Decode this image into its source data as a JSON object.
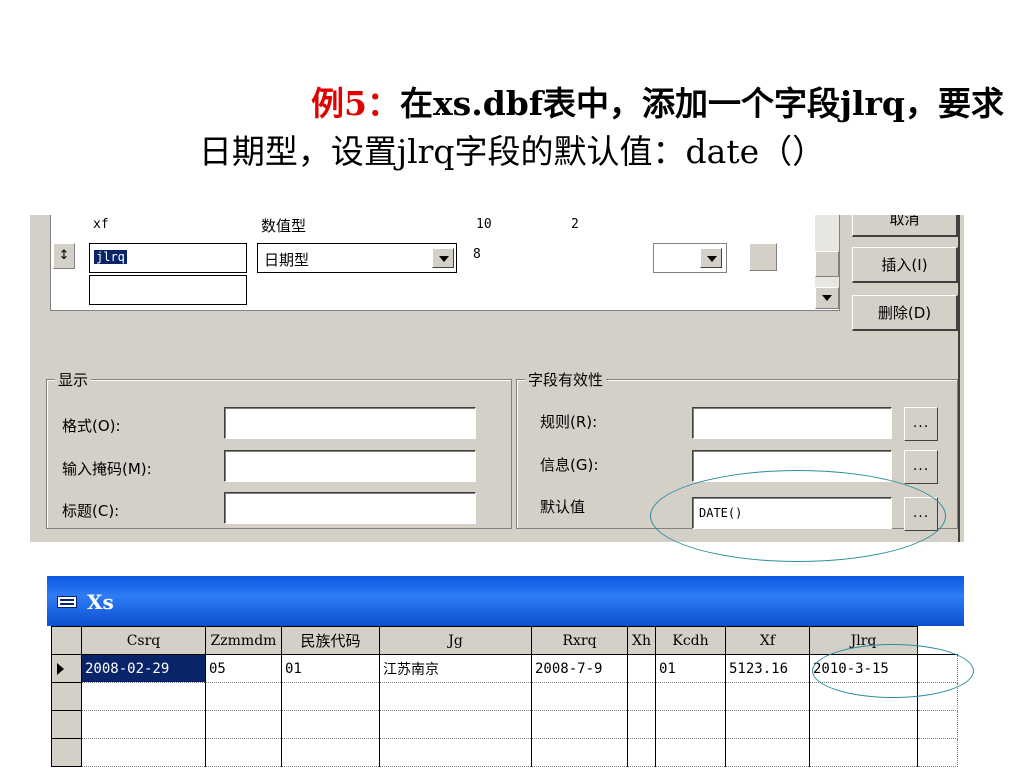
{
  "title": {
    "example_label": "例5：",
    "line1_text": "在xs.dbf表中，添加一个字段jlrq，要求",
    "line2_text": "日期型，设置jlrq字段的默认值：date（）"
  },
  "field_grid": {
    "row_prev": {
      "name": "xf",
      "type": "数值型",
      "width": "10",
      "decimal": "2"
    },
    "row_current": {
      "name": "jlrq",
      "type": "日期型",
      "width": "8"
    }
  },
  "buttons": {
    "cancel": "取消",
    "insert": "插入(I)",
    "delete": "删除(D)"
  },
  "display_group": {
    "legend": "显示",
    "format_label": "格式(O):",
    "mask_label": "输入掩码(M):",
    "caption_label": "标题(C):"
  },
  "validation_group": {
    "legend": "字段有效性",
    "rule_label": "规则(R):",
    "message_label": "信息(G):",
    "default_label": "默认值",
    "default_value": "DATE()",
    "dots": "..."
  },
  "browse": {
    "window_title": "Xs",
    "columns": [
      "Csrq",
      "Zzmmdm",
      "民族代码",
      "Jg",
      "Rxrq",
      "Xh",
      "Kcdh",
      "Xf",
      "Jlrq"
    ],
    "row1": [
      "2008-02-29",
      "05",
      "01",
      "江苏南京",
      "2008-7-9",
      "",
      "01",
      "5123.16",
      "2010-3-15"
    ]
  },
  "colors": {
    "title_accent": "#e00000",
    "dialog_face": "#d4d0c8",
    "titlebar_blue": "#0c57e0",
    "selection": "#0a246a",
    "annotation": "#2b8e9c"
  }
}
